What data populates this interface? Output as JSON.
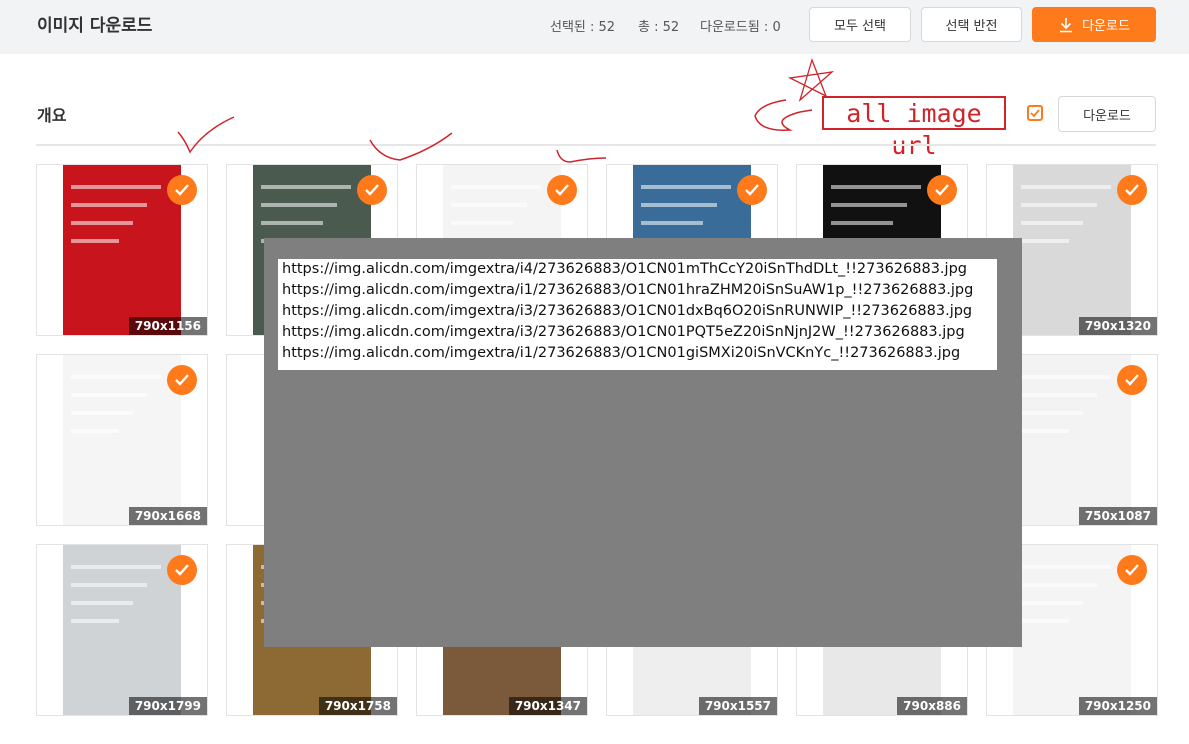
{
  "header": {
    "title": "이미지 다운로드",
    "selected": "선택된 : 52",
    "total": "총 : 52",
    "downloaded": "다운로드됨 : 0",
    "select_all": "모두 선택",
    "invert_selection": "선택 반전",
    "download": "다운로드"
  },
  "section": {
    "title": "개요",
    "annotation": "all image url",
    "download": "다운로드"
  },
  "colors": {
    "accent": "#ff7a1a",
    "annotation": "#d0232a",
    "overlay": "#7f7f7f"
  },
  "images": [
    {
      "size": "790x1156",
      "color": "#c8141c"
    },
    {
      "size": "",
      "color": "#4a5a4f"
    },
    {
      "size": "",
      "color": "#f4f4f4"
    },
    {
      "size": "",
      "color": "#3a6c9a"
    },
    {
      "size": "",
      "color": "#111111"
    },
    {
      "size": "790x1320",
      "color": "#d9d9d9"
    },
    {
      "size": "790x1668",
      "color": "#f5f5f5"
    },
    {
      "size": "",
      "color": "#ffffff"
    },
    {
      "size": "",
      "color": "#ffffff"
    },
    {
      "size": "",
      "color": "#ffffff"
    },
    {
      "size": "",
      "color": "#ffffff"
    },
    {
      "size": "750x1087",
      "color": "#f3f3f3"
    },
    {
      "size": "790x1799",
      "color": "#cfd3d6"
    },
    {
      "size": "790x1758",
      "color": "#8d6a33"
    },
    {
      "size": "790x1347",
      "color": "#7a5a3a"
    },
    {
      "size": "790x1557",
      "color": "#eeeeee"
    },
    {
      "size": "790x886",
      "color": "#e8e8e8"
    },
    {
      "size": "790x1250",
      "color": "#f4f4f4"
    }
  ],
  "overlay": {
    "urls": [
      "https://img.alicdn.com/imgextra/i4/273626883/O1CN01mThCcY20iSnThdDLt_!!273626883.jpg",
      "https://img.alicdn.com/imgextra/i1/273626883/O1CN01hraZHM20iSnSuAW1p_!!273626883.jpg",
      "https://img.alicdn.com/imgextra/i3/273626883/O1CN01dxBq6O20iSnRUNWIP_!!273626883.jpg",
      "https://img.alicdn.com/imgextra/i3/273626883/O1CN01PQT5eZ20iSnNjnJ2W_!!273626883.jpg",
      "https://img.alicdn.com/imgextra/i1/273626883/O1CN01giSMXi20iSnVCKnYc_!!273626883.jpg"
    ]
  },
  "icons": {
    "download": "download-icon",
    "check": "check-icon"
  }
}
